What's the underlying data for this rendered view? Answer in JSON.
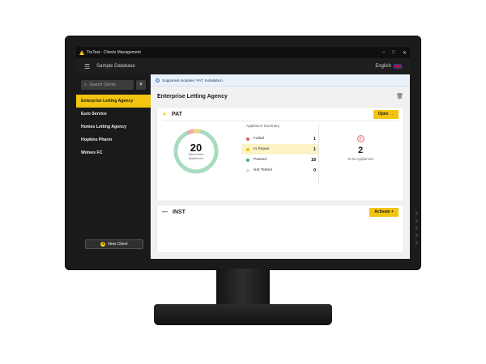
{
  "window": {
    "title": "TruTest - Clients Management"
  },
  "menubar": {
    "database": "Sample Database",
    "language": "English"
  },
  "sidebar": {
    "search_placeholder": "Search Clients",
    "clients": [
      {
        "label": "Enterprise Letting Agency",
        "active": true
      },
      {
        "label": "Euro Service",
        "active": false
      },
      {
        "label": "Homes Letting Agency",
        "active": false
      },
      {
        "label": "Hopkins Pharm",
        "active": false
      },
      {
        "label": "Wolves FC",
        "active": false
      }
    ],
    "new_client_label": "New Client"
  },
  "main": {
    "info": "Supported modules: PAT, Installation.",
    "client_name": "Enterprise Letting Agency",
    "pat": {
      "title": "PAT",
      "open_label": "Open",
      "total": "20",
      "total_label": "Total Active Appliances",
      "summary_title": "Appliance Summary",
      "rows": [
        {
          "label": "Failed",
          "value": "1",
          "color": "#e05b5b"
        },
        {
          "label": "In Repair",
          "value": "1",
          "color": "#f1c40f"
        },
        {
          "label": "Passed",
          "value": "18",
          "color": "#4caf7d"
        },
        {
          "label": "Not Tested",
          "value": "0",
          "color": "#d9d9d9"
        }
      ],
      "todo_count": "2",
      "todo_label": "To Do Appliances"
    },
    "inst": {
      "title": "INST",
      "activate_label": "Activate"
    }
  },
  "colors": {
    "accent": "#f1c40f",
    "sidebar": "#1a1a1a",
    "passed": "#a8dcc0",
    "failed": "#f3a8a8",
    "in_repair": "#f3d77a"
  }
}
